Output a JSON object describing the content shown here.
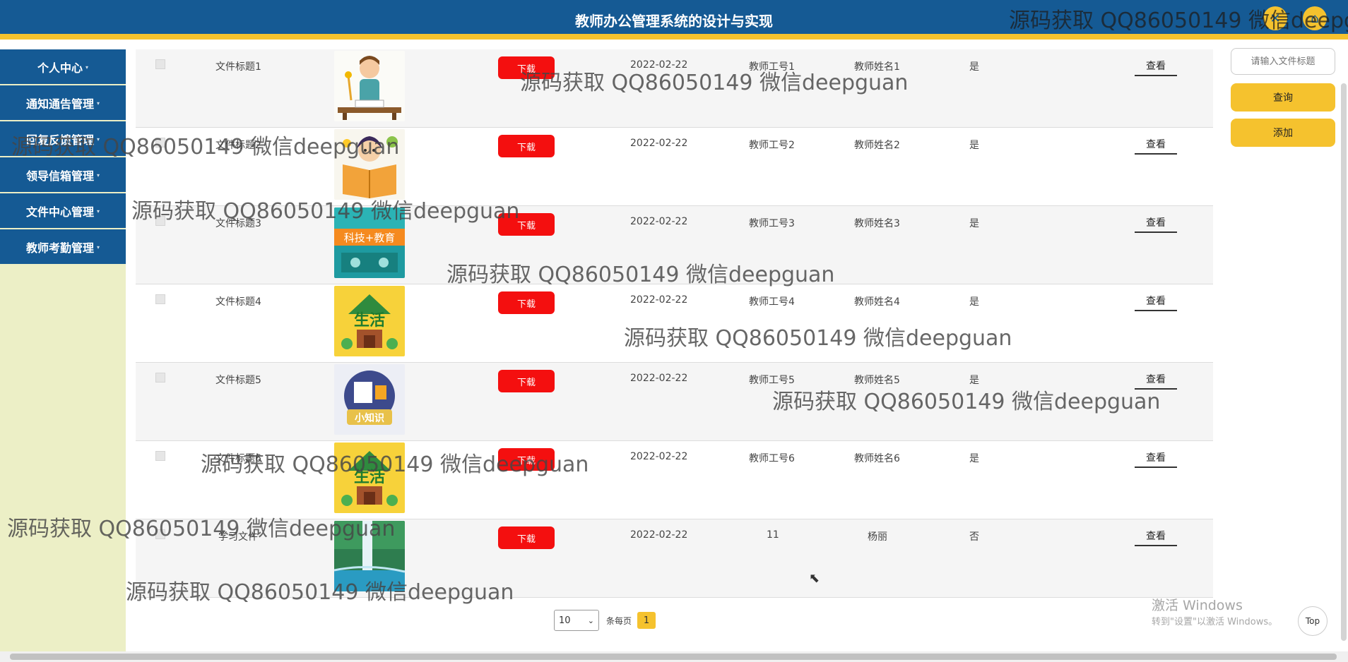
{
  "header": {
    "title": "教师办公管理系统的设计与实现"
  },
  "sidebar": {
    "items": [
      {
        "label": "个人中心"
      },
      {
        "label": "通知通告管理"
      },
      {
        "label": "回复反馈管理"
      },
      {
        "label": "领导信箱管理"
      },
      {
        "label": "文件中心管理"
      },
      {
        "label": "教师考勤管理"
      }
    ]
  },
  "table": {
    "rows": [
      {
        "title": "文件标题1",
        "download": "下载",
        "date": "2022-02-22",
        "teacher_no": "教师工号1",
        "teacher_name": "教师姓名1",
        "flag": "是",
        "view": "查看",
        "image": "teacher-at-desk"
      },
      {
        "title": "文件标题2",
        "download": "下载",
        "date": "2022-02-22",
        "teacher_no": "教师工号2",
        "teacher_name": "教师姓名2",
        "flag": "是",
        "view": "查看",
        "image": "child-reading-book"
      },
      {
        "title": "文件标题3",
        "download": "下载",
        "date": "2022-02-22",
        "teacher_no": "教师工号3",
        "teacher_name": "教师姓名3",
        "flag": "是",
        "view": "查看",
        "image": "tech-education-banner"
      },
      {
        "title": "文件标题4",
        "download": "下载",
        "date": "2022-02-22",
        "teacher_no": "教师工号4",
        "teacher_name": "教师姓名4",
        "flag": "是",
        "view": "查看",
        "image": "life-book-cover"
      },
      {
        "title": "文件标题5",
        "download": "下载",
        "date": "2022-02-22",
        "teacher_no": "教师工号5",
        "teacher_name": "教师姓名5",
        "flag": "是",
        "view": "查看",
        "image": "small-knowledge-badge"
      },
      {
        "title": "文件标题6",
        "download": "下载",
        "date": "2022-02-22",
        "teacher_no": "教师工号6",
        "teacher_name": "教师姓名6",
        "flag": "是",
        "view": "查看",
        "image": "life-book-cover"
      },
      {
        "title": "学习文件",
        "download": "下载",
        "date": "2022-02-22",
        "teacher_no": "11",
        "teacher_name": "杨丽",
        "flag": "否",
        "view": "查看",
        "image": "waterfall-landscape"
      }
    ]
  },
  "image_texts": {
    "tech": "科技+教育",
    "life": "生活",
    "knowledge": "小知识"
  },
  "right_panel": {
    "search_placeholder": "请输入文件标题",
    "query_label": "查询",
    "add_label": "添加"
  },
  "pagination": {
    "page_size": "10",
    "per_page_label": "条每页",
    "current_page": "1",
    "top_label": "Top"
  },
  "os_notice": {
    "line1": "激活 Windows",
    "line2": "转到\"设置\"以激活 Windows。"
  },
  "watermark": {
    "text": "源码获取 QQ86050149 微信deepguan",
    "header_text": "源码获取 QQ86050149 微信deepg"
  },
  "colors": {
    "header": "#155a94",
    "accent": "#f5c22e",
    "download": "#f40f0f",
    "sidebar_bg": "#ecefc6"
  }
}
